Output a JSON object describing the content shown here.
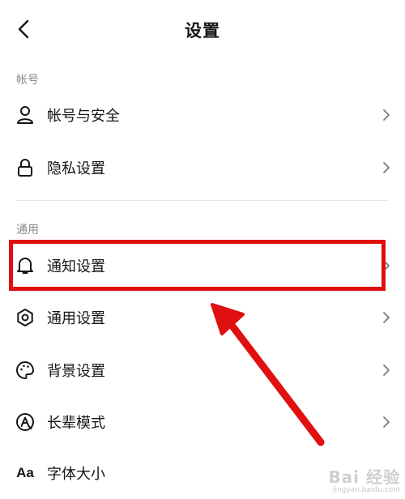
{
  "header": {
    "title": "设置"
  },
  "sections": {
    "account": {
      "label": "帐号",
      "items": [
        {
          "label": "帐号与安全",
          "icon": "person-icon"
        },
        {
          "label": "隐私设置",
          "icon": "lock-icon"
        }
      ]
    },
    "general": {
      "label": "通用",
      "items": [
        {
          "label": "通知设置",
          "icon": "bell-icon"
        },
        {
          "label": "通用设置",
          "icon": "gear-icon"
        },
        {
          "label": "背景设置",
          "icon": "palette-icon"
        },
        {
          "label": "长辈模式",
          "icon": "elder-mode-icon"
        },
        {
          "label": "字体大小",
          "icon": "font-size-icon",
          "icon_text": "Aa"
        }
      ]
    }
  },
  "annotation": {
    "highlight_color": "#e01010",
    "arrow_color": "#e01010"
  },
  "watermark": {
    "main": "Bai 经验",
    "sub": "jingyan.baidu.com"
  }
}
